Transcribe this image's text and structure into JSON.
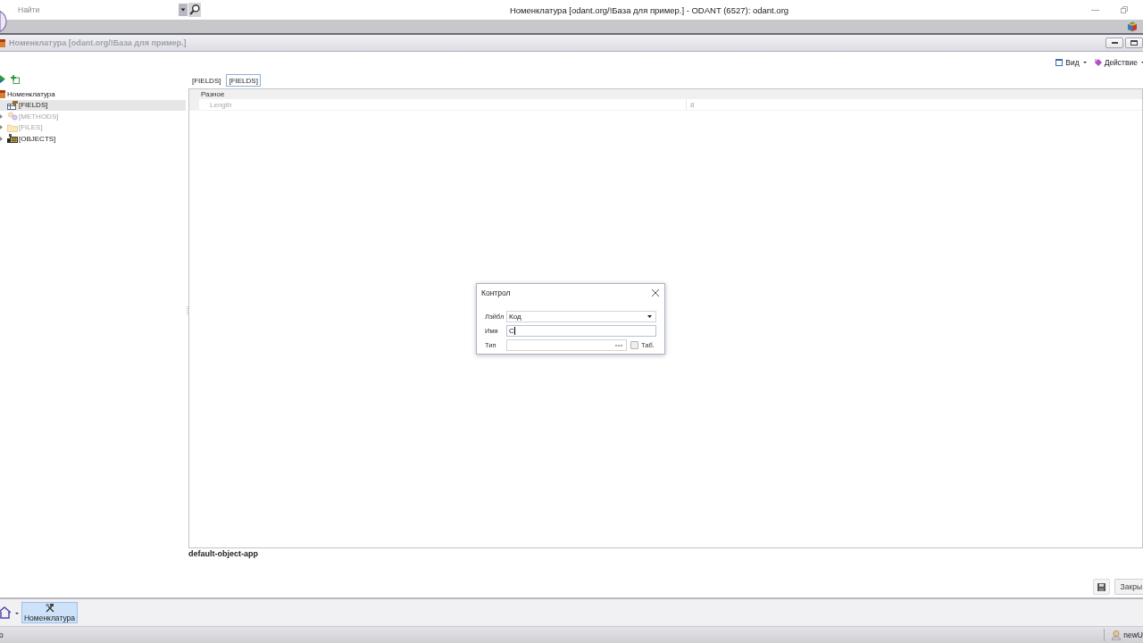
{
  "window": {
    "search": {
      "placeholder": "Найти"
    },
    "title": "Номенклатура [odant.org/!База для пример.] - ODANT (6527): odant.org"
  },
  "document": {
    "title": "Номенклатура [odant.org/!База для пример.]"
  },
  "toolbar": {
    "buttons": [
      {
        "label": "Вид",
        "kind": "view"
      },
      {
        "label": "Действие",
        "kind": "action"
      }
    ]
  },
  "tree": [
    {
      "label": "Номенклатура",
      "kind": "class",
      "selected": false,
      "disabled": false,
      "children": [
        {
          "label": "[FIELDS]",
          "kind": "fields",
          "expandable": false,
          "selected": true,
          "disabled": false
        },
        {
          "label": "[METHODS]",
          "kind": "methods",
          "expandable": true,
          "selected": false,
          "disabled": true
        },
        {
          "label": "[FILES]",
          "kind": "files",
          "expandable": true,
          "selected": false,
          "disabled": true
        },
        {
          "label": "[OBJECTS]",
          "kind": "objects",
          "expandable": true,
          "selected": false,
          "disabled": false
        }
      ]
    }
  ],
  "tabs": [
    {
      "label": "[FIELDS]",
      "selected": false
    },
    {
      "label": "[FIELDS]",
      "selected": true
    }
  ],
  "property_grid": {
    "categories": [
      {
        "label": "Разное",
        "rows": [
          {
            "name": "Length",
            "value": "8",
            "readonly": true
          }
        ]
      }
    ]
  },
  "app_label": "default-object-app",
  "footer": {
    "close_button": "Закры"
  },
  "taskbar": {
    "items": [
      {
        "label": "Номенклатура",
        "selected": true
      }
    ]
  },
  "status_bar": {
    "left_text": "о",
    "user": "newU"
  },
  "dialog": {
    "title": "Контрол",
    "fields": [
      {
        "label": "Лэйбл",
        "kind": "select",
        "value": "Код",
        "focused": false
      },
      {
        "label": "Имя",
        "kind": "text",
        "value": "С",
        "focused": true
      },
      {
        "label": "Тип",
        "kind": "browse",
        "focused": false,
        "checkbox": {
          "label": "Таб.",
          "checked": false
        }
      }
    ]
  }
}
